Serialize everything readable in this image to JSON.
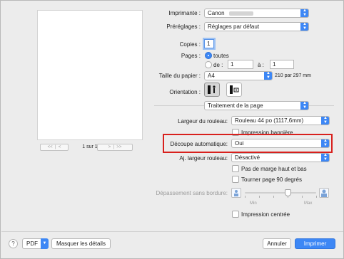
{
  "printer": {
    "label": "Imprimante :",
    "value": "Canon"
  },
  "presets": {
    "label": "Préréglages :",
    "value": "Réglages par défaut"
  },
  "copies": {
    "label": "Copies :",
    "value": "1"
  },
  "pages": {
    "label": "Pages :",
    "all_label": "toutes",
    "from_label": "de :",
    "from_value": "1",
    "to_label": "à :",
    "to_value": "1"
  },
  "paper_size": {
    "label": "Taille du papier :",
    "value": "A4",
    "dimensions": "210 par 297 mm"
  },
  "orientation": {
    "label": "Orientation :"
  },
  "section": {
    "value": "Traitement de la page"
  },
  "roll_width": {
    "label": "Largeur du rouleau:",
    "value": "Rouleau 44 po (1117,6mm)"
  },
  "banner": {
    "label": "Impression bannière",
    "checked": false
  },
  "auto_cut": {
    "label": "Découpe automatique:",
    "value": "Oui"
  },
  "adjust_width": {
    "label": "Aj. largeur rouleau:",
    "value": "Désactivé"
  },
  "no_margin": {
    "label": "Pas de marge haut et bas",
    "checked": false
  },
  "rotate": {
    "label": "Tourner page 90 degrés",
    "checked": false
  },
  "overflow": {
    "label": "Dépassement sans bordure:",
    "min_label": "Min",
    "max_label": "Max",
    "level": 0.6
  },
  "centered": {
    "label": "Impression centrée",
    "checked": false
  },
  "preview_nav": {
    "first": "<<",
    "prev": "<",
    "page_info": "1 sur 1",
    "next": ">",
    "last": ">>"
  },
  "footer": {
    "help": "?",
    "pdf": "PDF",
    "details": "Masquer les détails",
    "cancel": "Annuler",
    "print": "Imprimer"
  }
}
